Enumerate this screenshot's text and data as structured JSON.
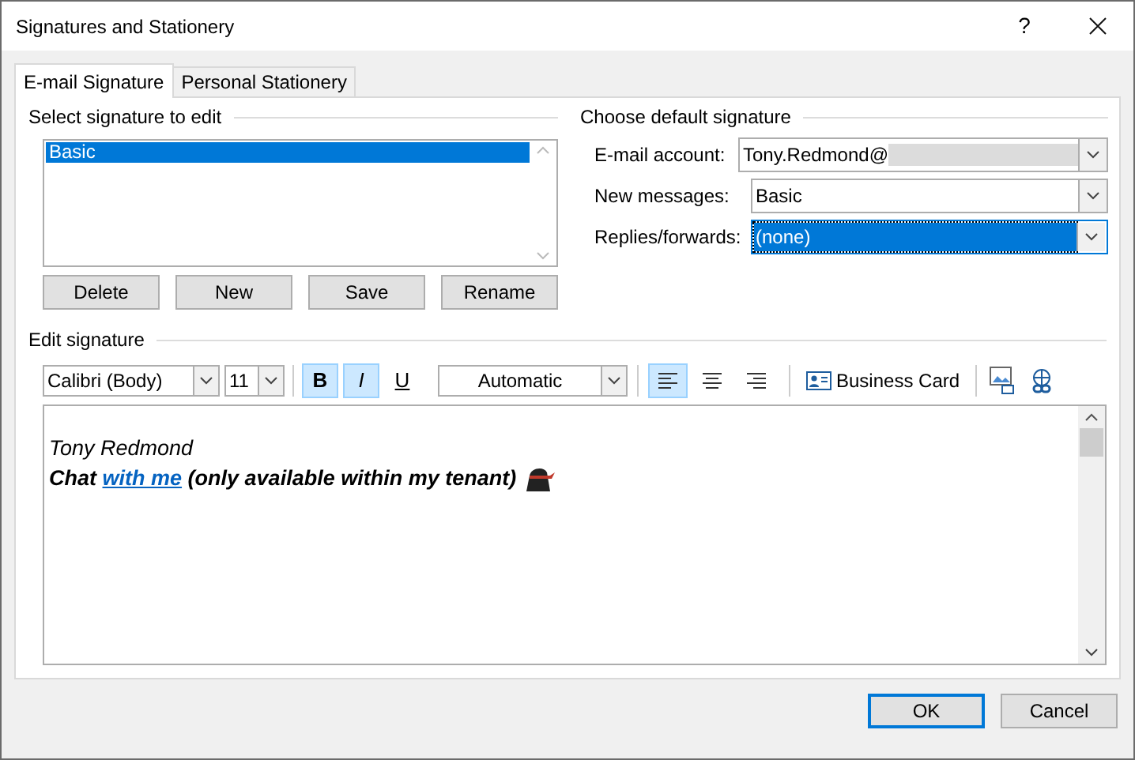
{
  "window": {
    "title": "Signatures and Stationery",
    "help": "?"
  },
  "tabs": [
    {
      "label": "E-mail Signature",
      "selected": true
    },
    {
      "label": "Personal Stationery",
      "selected": false
    }
  ],
  "select_signature": {
    "heading": "Select signature to edit",
    "items": [
      {
        "label": "Basic",
        "selected": true
      }
    ],
    "buttons": [
      "Delete",
      "New",
      "Save",
      "Rename"
    ]
  },
  "default_signature": {
    "heading": "Choose default signature",
    "fields": [
      {
        "label": "E-mail account:",
        "value": "Tony.Redmond@",
        "redacted": true,
        "selected": false
      },
      {
        "label": "New messages:",
        "value": "Basic",
        "redacted": false,
        "selected": false
      },
      {
        "label": "Replies/forwards:",
        "value": "(none)",
        "redacted": false,
        "selected": true
      }
    ]
  },
  "edit_signature": {
    "heading": "Edit signature",
    "font": "Calibri (Body)",
    "size": "11",
    "format": [
      {
        "kind": "bold",
        "label": "B",
        "on": true
      },
      {
        "kind": "italic",
        "label": "I",
        "on": true
      },
      {
        "kind": "underline",
        "label": "U",
        "on": false
      }
    ],
    "text_color_label": "Automatic",
    "align": [
      {
        "kind": "left",
        "selected": true
      },
      {
        "kind": "center",
        "selected": false
      },
      {
        "kind": "right",
        "selected": false
      }
    ],
    "business_card": "Business Card",
    "lines": [
      {
        "kind": "plain",
        "text": "Tony Redmond"
      },
      {
        "kind": "link",
        "before": "Chat",
        "link": "with me",
        "after": "(only available within my tenant)"
      }
    ]
  },
  "buttons": [
    {
      "label": "OK",
      "default": true
    },
    {
      "label": "Cancel",
      "default": false
    }
  ]
}
